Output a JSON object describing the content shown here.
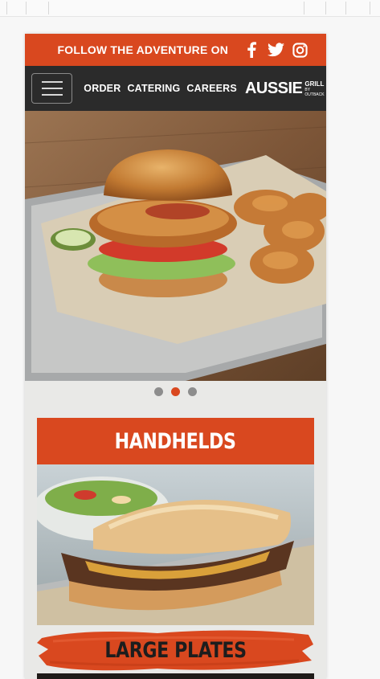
{
  "social": {
    "text": "FOLLOW THE ADVENTURE ON",
    "icons": [
      "facebook-icon",
      "twitter-icon",
      "instagram-icon"
    ]
  },
  "nav": {
    "links": [
      "ORDER",
      "CATERING",
      "CAREERS"
    ],
    "logo_main": "AUSSIE",
    "logo_side": "GRILL",
    "logo_by": "BY OUTBACK"
  },
  "carousel": {
    "slide_count": 3,
    "active_index": 1
  },
  "sections": [
    {
      "title": "HANDHELDS"
    },
    {
      "title": "LARGE PLATES"
    }
  ],
  "colors": {
    "brand_orange": "#d9481f",
    "nav_dark": "#2b2b2b",
    "dot_inactive": "#8d8d8d"
  }
}
